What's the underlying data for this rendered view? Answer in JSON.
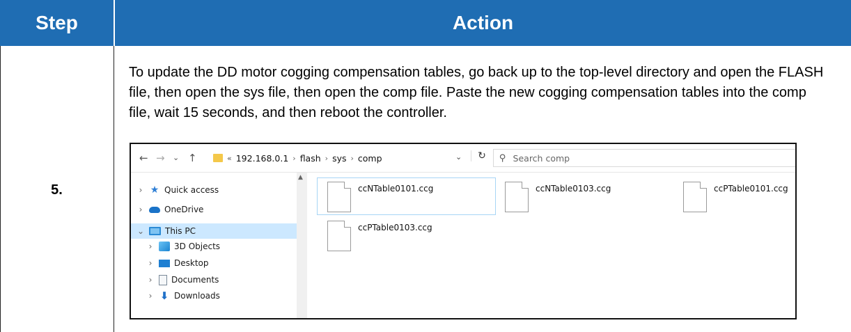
{
  "table": {
    "header_step": "Step",
    "header_action": "Action",
    "step_number": "5.",
    "action_text": "To update the DD motor cogging compensation tables, go back up to the top-level directory and open the FLASH file, then open the sys file, then open the comp file. Paste the new cogging compensation tables into the comp file, wait 15 seconds, and then reboot the controller."
  },
  "explorer": {
    "nav": {
      "back": "←",
      "forward": "→",
      "recent": "⌄",
      "up": "↑"
    },
    "breadcrumb": [
      "«",
      "192.168.0.1",
      "flash",
      "sys",
      "comp"
    ],
    "breadcrumb_sep": "›",
    "address_dropdown": "⌄",
    "refresh": "↻",
    "search_placeholder": "Search comp",
    "sidebar": [
      {
        "label": "Quick access",
        "icon": "star-icon",
        "chevron": "›"
      },
      {
        "label": "OneDrive",
        "icon": "cloud-icon",
        "chevron": "›"
      },
      {
        "label": "This PC",
        "icon": "computer-icon",
        "chevron": "⌄",
        "selected": true
      },
      {
        "label": "3D Objects",
        "icon": "cube-icon",
        "chevron": "›"
      },
      {
        "label": "Desktop",
        "icon": "desktop-icon",
        "chevron": "›"
      },
      {
        "label": "Documents",
        "icon": "documents-icon",
        "chevron": "›"
      },
      {
        "label": "Downloads",
        "icon": "download-icon",
        "chevron": "›"
      }
    ],
    "files": [
      {
        "name": "ccNTable0101.ccg",
        "selected": true
      },
      {
        "name": "ccNTable0103.ccg"
      },
      {
        "name": "ccPTable0101.ccg"
      },
      {
        "name": "ccPTable0103.ccg"
      }
    ]
  },
  "colors": {
    "header_bg": "#1f6db3",
    "selected_bg": "#cce8ff"
  }
}
